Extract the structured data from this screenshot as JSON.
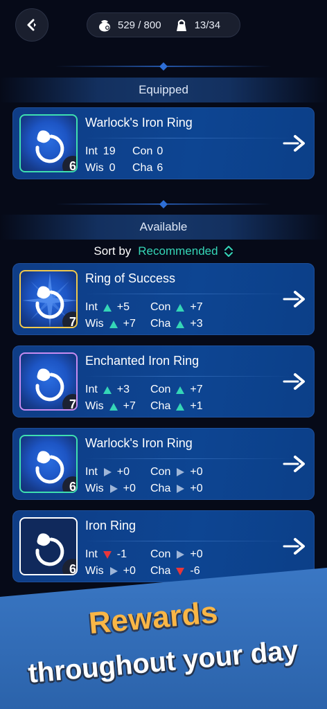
{
  "topbar": {
    "back_icon": "back-arrow-icon",
    "currency_icon": "coin-bag-icon",
    "currency_text": "529 / 800",
    "lock_icon": "lock-icon",
    "slots_text": "13/34"
  },
  "sections": {
    "equipped": "Equipped",
    "available": "Available"
  },
  "sort": {
    "label": "Sort by",
    "value": "Recommended"
  },
  "colors": {
    "positive": "#35d6b7",
    "neutral": "#9fb6d8",
    "negative": "#e8363a",
    "border_gold": "#f2c94c",
    "border_purple": "#c78cf2",
    "border_green": "#3ee0b0",
    "border_white": "#ffffff"
  },
  "equipped_item": {
    "name": "Warlock's Iron Ring",
    "level": "6",
    "stats": {
      "int_label": "Int",
      "int_value": "19",
      "con_label": "Con",
      "con_value": "0",
      "wis_label": "Wis",
      "wis_value": "0",
      "cha_label": "Cha",
      "cha_value": "6"
    }
  },
  "available_items": [
    {
      "name": "Ring of Success",
      "level": "7",
      "stats": {
        "int_label": "Int",
        "int_value": "+5",
        "con_label": "Con",
        "con_value": "+7",
        "wis_label": "Wis",
        "wis_value": "+7",
        "cha_label": "Cha",
        "cha_value": "+3"
      }
    },
    {
      "name": "Enchanted Iron Ring",
      "level": "7",
      "stats": {
        "int_label": "Int",
        "int_value": "+3",
        "con_label": "Con",
        "con_value": "+7",
        "wis_label": "Wis",
        "wis_value": "+7",
        "cha_label": "Cha",
        "cha_value": "+1"
      }
    },
    {
      "name": "Warlock's Iron Ring",
      "level": "6",
      "stats": {
        "int_label": "Int",
        "int_value": "+0",
        "con_label": "Con",
        "con_value": "+0",
        "wis_label": "Wis",
        "wis_value": "+0",
        "cha_label": "Cha",
        "cha_value": "+0"
      }
    },
    {
      "name": "Iron Ring",
      "level": "6",
      "stats": {
        "int_label": "Int",
        "int_value": "-1",
        "con_label": "Con",
        "con_value": "+0",
        "wis_label": "Wis",
        "wis_value": "+0",
        "cha_label": "Cha",
        "cha_value": "-6"
      }
    }
  ],
  "promo": {
    "line1": "Rewards",
    "line2": "throughout your day"
  }
}
